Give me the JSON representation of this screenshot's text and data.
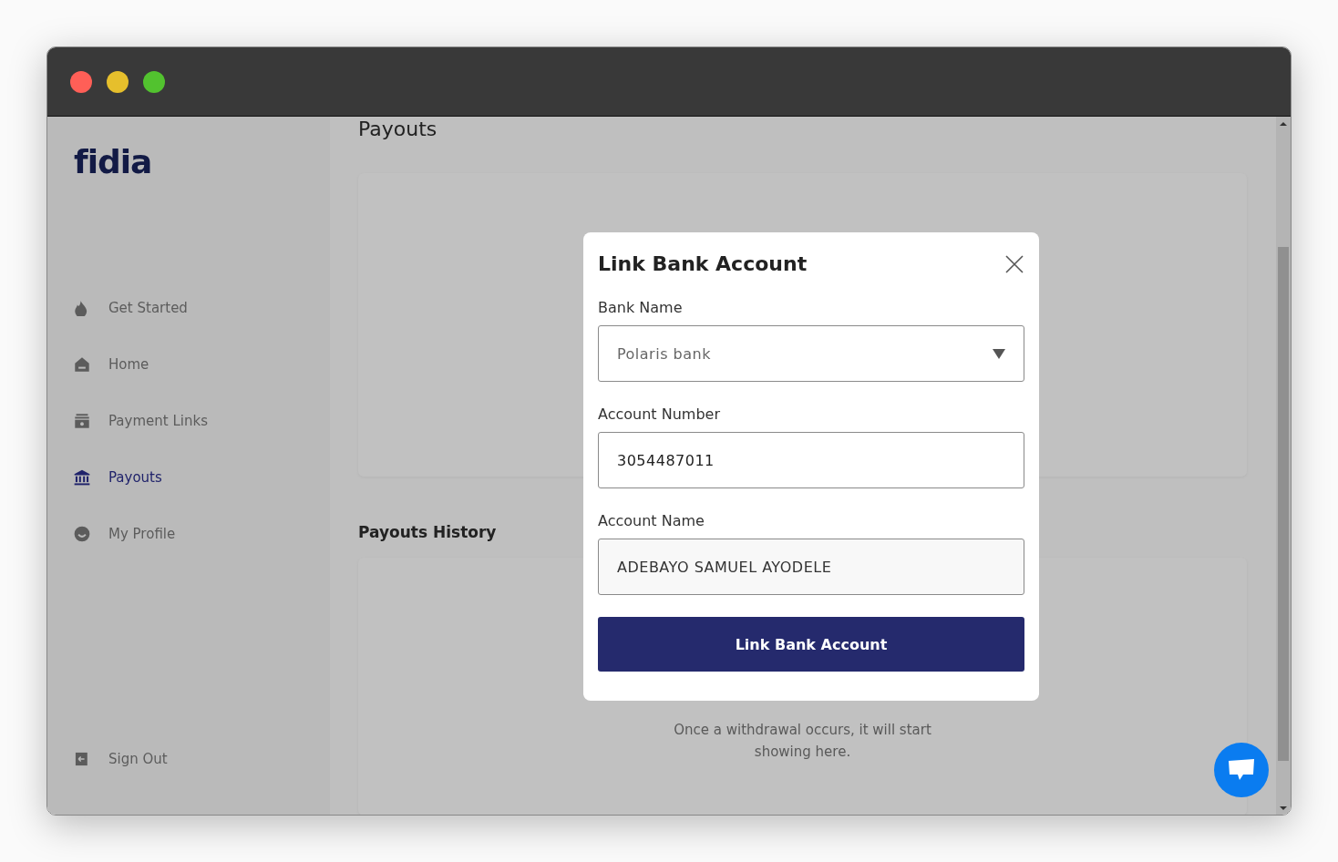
{
  "window": {
    "controls": [
      {
        "color": "#ff5f57"
      },
      {
        "color": "#e6bf2c"
      },
      {
        "color": "#52c22f"
      }
    ]
  },
  "sidebar": {
    "logo": "fidia",
    "items": [
      {
        "label": "Get Started",
        "selected": false
      },
      {
        "label": "Home",
        "selected": false
      },
      {
        "label": "Payment Links",
        "selected": false
      },
      {
        "label": "Payouts",
        "selected": true
      },
      {
        "label": "My Profile",
        "selected": false
      }
    ],
    "footer_item": {
      "label": "Sign Out"
    }
  },
  "main": {
    "heading": "Payouts",
    "history_heading": "Payouts History",
    "empty_message": "Once a withdrawal occurs, it will start showing here."
  },
  "modal": {
    "title": "Link Bank Account",
    "fields": [
      {
        "label": "Bank Name",
        "kind": "select",
        "value": "Polaris bank"
      },
      {
        "label": "Account Number",
        "kind": "input",
        "value": "3054487011"
      },
      {
        "label": "Account Name",
        "kind": "readonly",
        "value": "ADEBAYO SAMUEL AYODELE"
      }
    ],
    "submit": "Link Bank Account"
  }
}
